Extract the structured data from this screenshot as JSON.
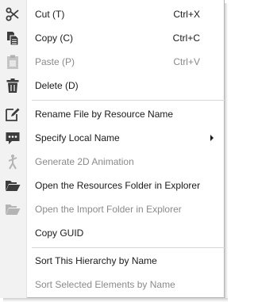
{
  "menu": {
    "items": [
      {
        "label": "Cut (T)",
        "shortcut": "Ctrl+X",
        "icon": "scissors-icon",
        "enabled": true
      },
      {
        "label": "Copy (C)",
        "shortcut": "Ctrl+C",
        "icon": "copy-icon",
        "enabled": true
      },
      {
        "label": "Paste (P)",
        "shortcut": "Ctrl+V",
        "icon": "paste-icon",
        "enabled": false
      },
      {
        "label": "Delete (D)",
        "shortcut": "",
        "icon": "trash-icon",
        "enabled": true
      },
      {
        "label": "Rename File by Resource Name",
        "shortcut": "",
        "icon": "rename-icon",
        "enabled": true
      },
      {
        "label": "Specify Local Name",
        "shortcut": "",
        "icon": "speech-bubble-icon",
        "enabled": true,
        "submenu": true
      },
      {
        "label": "Generate 2D Animation",
        "shortcut": "",
        "icon": "animation-figure-icon",
        "enabled": false
      },
      {
        "label": "Open the Resources Folder in Explorer",
        "shortcut": "",
        "icon": "open-folder-icon",
        "enabled": true
      },
      {
        "label": "Open the Import Folder in Explorer",
        "shortcut": "",
        "icon": "open-folder-icon",
        "enabled": false
      },
      {
        "label": "Copy GUID",
        "shortcut": "",
        "icon": "",
        "enabled": true
      },
      {
        "label": "Sort This Hierarchy by Name",
        "shortcut": "",
        "icon": "",
        "enabled": true
      },
      {
        "label": "Sort Selected Elements by Name",
        "shortcut": "",
        "icon": "",
        "enabled": false
      }
    ]
  },
  "colors": {
    "icon": "#3c3c3c",
    "icon_disabled": "#b4b4b4",
    "text": "#1a1a1a",
    "text_disabled": "#8a8a8a"
  }
}
